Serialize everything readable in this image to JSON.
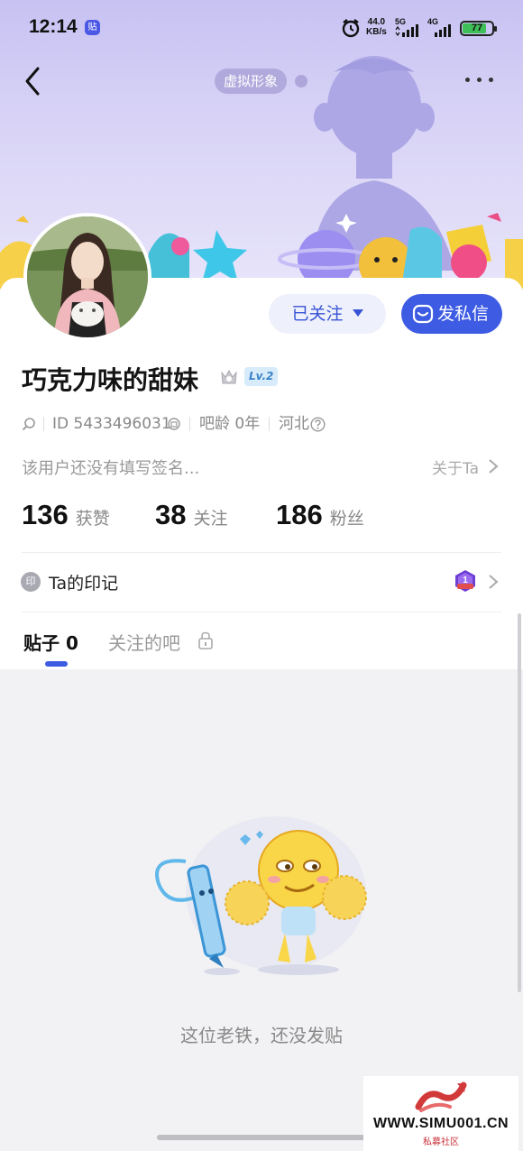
{
  "status_bar": {
    "time": "12:14",
    "notif_badge": "贴",
    "net_speed_value": "44.0",
    "net_speed_unit": "KB/s",
    "sig1_label": "5G",
    "sig2_label": "4G",
    "battery": "77"
  },
  "header": {
    "avatar_tag": "虚拟形象"
  },
  "profile": {
    "username": "巧克力味的甜妹",
    "level": "Lv.2",
    "id_text": "ID 5433496031",
    "age_text": "吧龄 0年",
    "location": "河北",
    "signature": "该用户还没有填写签名...",
    "about_link": "关于Ta"
  },
  "actions": {
    "follow_label": "已关注",
    "message_label": "发私信"
  },
  "stats": [
    {
      "num": "136",
      "label": "获赞"
    },
    {
      "num": "38",
      "label": "关注"
    },
    {
      "num": "186",
      "label": "粉丝"
    }
  ],
  "seal": {
    "icon_char": "印",
    "label": "Ta的印记",
    "badge_num": "1"
  },
  "tabs": {
    "posts_label": "贴子 0",
    "bars_label": "关注的吧"
  },
  "empty": {
    "message": "这位老铁，还没发贴"
  },
  "watermark": {
    "text": "WWW.SIMU001.CN",
    "sub": "私募社区"
  },
  "colors": {
    "accent": "#3d5be3",
    "header_bg": "#c7c2f2"
  }
}
